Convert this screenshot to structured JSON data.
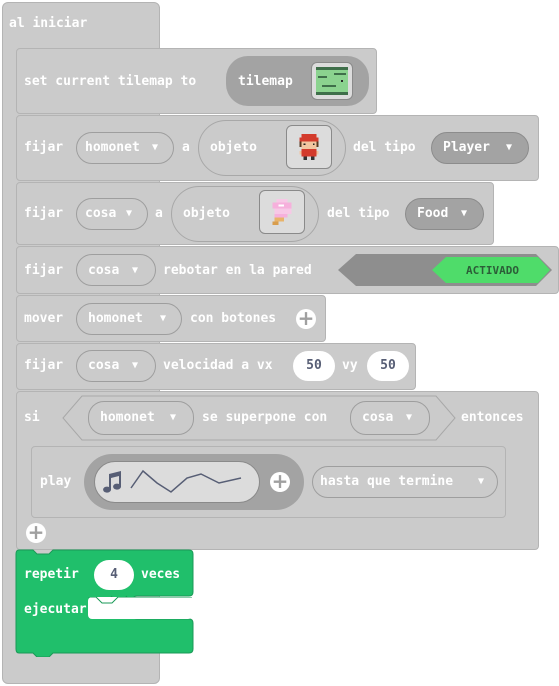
{
  "on_start": {
    "label": "al iniciar"
  },
  "tilemap_block": {
    "label": "set current tilemap to",
    "value": "tilemap"
  },
  "sprite1": {
    "fijar": "fijar",
    "var": "homonet",
    "a": "a",
    "objeto": "objeto",
    "tipo_label": "del tipo",
    "tipo": "Player"
  },
  "sprite2": {
    "fijar": "fijar",
    "var": "cosa",
    "a": "a",
    "objeto": "objeto",
    "tipo_label": "del tipo",
    "tipo": "Food"
  },
  "bounce": {
    "fijar": "fijar",
    "var": "cosa",
    "label": "rebotar en la pared",
    "toggle": "ACTIVADO"
  },
  "move": {
    "label": "mover",
    "var": "homonet",
    "suffix": "con botones"
  },
  "velocity": {
    "fijar": "fijar",
    "var": "cosa",
    "label": "velocidad a vx",
    "vx": "50",
    "vy_label": "vy",
    "vy": "50"
  },
  "if_block": {
    "si": "si",
    "a": "homonet",
    "overlaps": "se superpone con",
    "b": "cosa",
    "then": "entonces"
  },
  "play": {
    "label": "play",
    "mode": "hasta que termine"
  },
  "repeat": {
    "label": "repetir",
    "times": "4",
    "suffix": "veces",
    "exec": "ejecutar"
  },
  "colors": {
    "block_gray": "#cbcbcb",
    "dark_gray": "#a3a3a3",
    "loop_green": "#20bf6b",
    "toggle_green": "#4fdc6a"
  },
  "icons": [
    "plus-icon",
    "music-note-icon",
    "caret-down-icon",
    "tilemap-thumbnail-icon",
    "player-sprite-icon",
    "ice-cream-sprite-icon"
  ]
}
